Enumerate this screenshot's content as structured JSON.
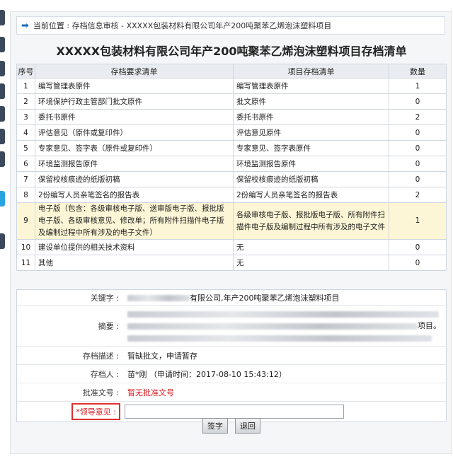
{
  "breadcrumb": {
    "icon": "arrow-right-icon",
    "label": "当前位置 : 存档信息审核 - XXXXX包装材料有限公司年产200吨聚苯乙烯泡沫塑料项目"
  },
  "title": "XXXXX包装材料有限公司年产200吨聚苯乙烯泡沫塑料项目存档清单",
  "table": {
    "headers": [
      "序号",
      "存档要求清单",
      "项目存档清单",
      "数量"
    ],
    "rows": [
      {
        "no": "1",
        "req": "编写管理表原件",
        "proj": "编写管理表原件",
        "qty": "1"
      },
      {
        "no": "2",
        "req": "环境保护行政主管部门批文原件",
        "proj": "批文原件",
        "qty": "0"
      },
      {
        "no": "3",
        "req": "委托书原件",
        "proj": "委托书原件",
        "qty": "2"
      },
      {
        "no": "4",
        "req": "评估意见（原件或复印件）",
        "proj": "评估意见原件",
        "qty": "0"
      },
      {
        "no": "5",
        "req": "专家意见、签字表（原件或复印件）",
        "proj": "专家意见、签字表原件",
        "qty": "0"
      },
      {
        "no": "6",
        "req": "环境监测报告原件",
        "proj": "环境监测报告原件",
        "qty": "0"
      },
      {
        "no": "7",
        "req": "保留校核痕迹的纸版初稿",
        "proj": "保留校核痕迹的纸版初稿",
        "qty": "0"
      },
      {
        "no": "8",
        "req": "2份编写人员亲笔签名的报告表",
        "proj": "2份编写人员亲笔签名的报告表",
        "qty": "2"
      },
      {
        "no": "9",
        "req": "电子版（包含：各级审核电子版、送审版电子版、报批版电子版、各级审核意见、修改单；所有附件扫描件电子版及编制过程中所有涉及的电子文件）",
        "proj": "各级审核电子版、报批版电子版、所有附件扫描件电子版及编制过程中所有涉及的电子文件",
        "qty": "1"
      },
      {
        "no": "10",
        "req": "建设单位提供的相关技术资料",
        "proj": "无",
        "qty": "0"
      },
      {
        "no": "11",
        "req": "其他",
        "proj": "无",
        "qty": "0"
      }
    ]
  },
  "form": {
    "keyword_label": "关键字 :",
    "keyword_value": "有限公司,年产200吨聚苯乙烯泡沫塑料项目",
    "abstract_label": "摘要 :",
    "abstract_tail": "项目。",
    "desc_label": "存档描述 :",
    "desc_value": "暂缺批文，申请暂存",
    "person_label": "存档人 :",
    "person_value": "苗*刚 （申请时间：2017-08-10 15:43:12）",
    "approval_label": "批准文号 :",
    "approval_value": "暂无批准文号",
    "leader_label": "*领导意见 :"
  },
  "buttons": {
    "sign": "签字",
    "back": "退回"
  },
  "colors": {
    "accent": "#1f6fb5",
    "highlight_row": "#fdf6d6",
    "warning_text": "#d9181e"
  }
}
